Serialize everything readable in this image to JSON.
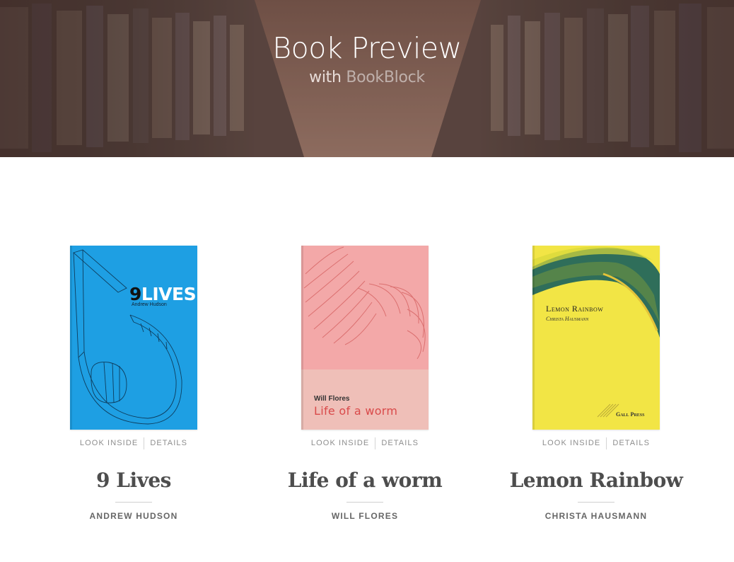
{
  "header": {
    "title": "Book Preview",
    "subtitle_with": "with",
    "subtitle_brand": "BookBlock"
  },
  "actions": {
    "look_inside": "LOOK INSIDE",
    "details": "DETAILS"
  },
  "books": [
    {
      "title": "9 Lives",
      "author": "ANDREW HUDSON",
      "cover": {
        "title_num": "9",
        "title_word": "LIVES",
        "author": "Andrew Hudson",
        "bg": "#1e9fe3"
      }
    },
    {
      "title": "Life of a worm",
      "author": "WILL FLORES",
      "cover": {
        "author": "Will Flores",
        "title": "Life of a worm",
        "bg": "#f3a8a8"
      }
    },
    {
      "title": "Lemon Rainbow",
      "author": "CHRISTA HAUSMANN",
      "cover": {
        "title": "Lemon Rainbow",
        "author": "Christa Hausmann",
        "publisher": "Gall Press",
        "bg": "#f2e545"
      }
    }
  ]
}
